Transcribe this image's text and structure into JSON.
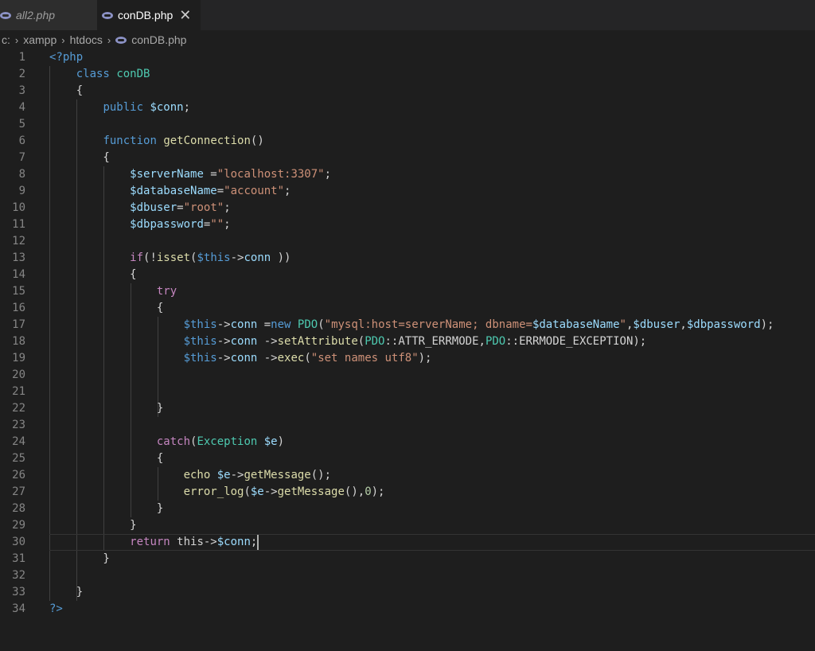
{
  "tabs": [
    {
      "label": "all2.php",
      "active": false,
      "icon": "php-icon"
    },
    {
      "label": "conDB.php",
      "active": true,
      "icon": "php-icon",
      "close_glyph": "✕"
    }
  ],
  "breadcrumb": [
    "c:",
    "xampp",
    "htdocs",
    "conDB.php"
  ],
  "editor": {
    "line_numbers": [
      "1",
      "2",
      "3",
      "4",
      "5",
      "6",
      "7",
      "8",
      "9",
      "10",
      "11",
      "12",
      "13",
      "14",
      "15",
      "16",
      "17",
      "18",
      "19",
      "20",
      "21",
      "22",
      "23",
      "24",
      "25",
      "26",
      "27",
      "28",
      "29",
      "30",
      "31",
      "32",
      "33",
      "34"
    ],
    "current_line": 30,
    "lines": [
      [
        [
          "k",
          "<?php"
        ]
      ],
      [
        [
          "p",
          "    "
        ],
        [
          "k",
          "class"
        ],
        [
          "p",
          " "
        ],
        [
          "c",
          "conDB"
        ]
      ],
      [
        [
          "p",
          "    {"
        ]
      ],
      [
        [
          "p",
          "        "
        ],
        [
          "k",
          "public"
        ],
        [
          "p",
          " "
        ],
        [
          "v",
          "$conn"
        ],
        [
          "p",
          ";"
        ]
      ],
      [],
      [
        [
          "p",
          "        "
        ],
        [
          "k",
          "function"
        ],
        [
          "p",
          " "
        ],
        [
          "f",
          "getConnection"
        ],
        [
          "p",
          "()"
        ]
      ],
      [
        [
          "p",
          "        {"
        ]
      ],
      [
        [
          "p",
          "            "
        ],
        [
          "v",
          "$serverName"
        ],
        [
          "p",
          " ="
        ],
        [
          "s",
          "\"localhost:3307\""
        ],
        [
          "p",
          ";"
        ]
      ],
      [
        [
          "p",
          "            "
        ],
        [
          "v",
          "$databaseName"
        ],
        [
          "p",
          "="
        ],
        [
          "s",
          "\"account\""
        ],
        [
          "p",
          ";"
        ]
      ],
      [
        [
          "p",
          "            "
        ],
        [
          "v",
          "$dbuser"
        ],
        [
          "p",
          "="
        ],
        [
          "s",
          "\"root\""
        ],
        [
          "p",
          ";"
        ]
      ],
      [
        [
          "p",
          "            "
        ],
        [
          "v",
          "$dbpassword"
        ],
        [
          "p",
          "="
        ],
        [
          "s",
          "\"\""
        ],
        [
          "p",
          ";"
        ]
      ],
      [],
      [
        [
          "p",
          "            "
        ],
        [
          "ctl",
          "if"
        ],
        [
          "p",
          "(!"
        ],
        [
          "f",
          "isset"
        ],
        [
          "p",
          "("
        ],
        [
          "k",
          "$this"
        ],
        [
          "p",
          "->"
        ],
        [
          "v",
          "conn"
        ],
        [
          "p",
          " ))"
        ]
      ],
      [
        [
          "p",
          "            {"
        ]
      ],
      [
        [
          "p",
          "                "
        ],
        [
          "ctl",
          "try"
        ]
      ],
      [
        [
          "p",
          "                {"
        ]
      ],
      [
        [
          "p",
          "                    "
        ],
        [
          "k",
          "$this"
        ],
        [
          "p",
          "->"
        ],
        [
          "v",
          "conn"
        ],
        [
          "p",
          " ="
        ],
        [
          "k",
          "new"
        ],
        [
          "p",
          " "
        ],
        [
          "c",
          "PDO"
        ],
        [
          "p",
          "("
        ],
        [
          "s",
          "\"mysql:host=serverName; dbname="
        ],
        [
          "v",
          "$databaseName"
        ],
        [
          "s",
          "\""
        ],
        [
          "p",
          ","
        ],
        [
          "v",
          "$dbuser"
        ],
        [
          "p",
          ","
        ],
        [
          "v",
          "$dbpassword"
        ],
        [
          "p",
          ");"
        ]
      ],
      [
        [
          "p",
          "                    "
        ],
        [
          "k",
          "$this"
        ],
        [
          "p",
          "->"
        ],
        [
          "v",
          "conn"
        ],
        [
          "p",
          " ->"
        ],
        [
          "f",
          "setAttribute"
        ],
        [
          "p",
          "("
        ],
        [
          "c",
          "PDO"
        ],
        [
          "p",
          "::ATTR_ERRMODE,"
        ],
        [
          "c",
          "PDO"
        ],
        [
          "p",
          "::ERRMODE_EXCEPTION);"
        ]
      ],
      [
        [
          "p",
          "                    "
        ],
        [
          "k",
          "$this"
        ],
        [
          "p",
          "->"
        ],
        [
          "v",
          "conn"
        ],
        [
          "p",
          " ->"
        ],
        [
          "f",
          "exec"
        ],
        [
          "p",
          "("
        ],
        [
          "s",
          "\"set names utf8\""
        ],
        [
          "p",
          ");"
        ]
      ],
      [],
      [],
      [
        [
          "p",
          "                }"
        ]
      ],
      [],
      [
        [
          "p",
          "                "
        ],
        [
          "ctl",
          "catch"
        ],
        [
          "p",
          "("
        ],
        [
          "c",
          "Exception"
        ],
        [
          "p",
          " "
        ],
        [
          "v",
          "$e"
        ],
        [
          "p",
          ")"
        ]
      ],
      [
        [
          "p",
          "                {"
        ]
      ],
      [
        [
          "p",
          "                    "
        ],
        [
          "f",
          "echo"
        ],
        [
          "p",
          " "
        ],
        [
          "v",
          "$e"
        ],
        [
          "p",
          "->"
        ],
        [
          "f",
          "getMessage"
        ],
        [
          "p",
          "();"
        ]
      ],
      [
        [
          "p",
          "                    "
        ],
        [
          "f",
          "error_log"
        ],
        [
          "p",
          "("
        ],
        [
          "v",
          "$e"
        ],
        [
          "p",
          "->"
        ],
        [
          "f",
          "getMessage"
        ],
        [
          "p",
          "(),"
        ],
        [
          "n",
          "0"
        ],
        [
          "p",
          ");"
        ]
      ],
      [
        [
          "p",
          "                }"
        ]
      ],
      [
        [
          "p",
          "            }"
        ]
      ],
      [
        [
          "p",
          "            "
        ],
        [
          "ctl",
          "return"
        ],
        [
          "p",
          " this->"
        ],
        [
          "v",
          "$conn"
        ],
        [
          "p",
          ";"
        ]
      ],
      [
        [
          "p",
          "        }"
        ]
      ],
      [],
      [
        [
          "p",
          "    }"
        ]
      ],
      [
        [
          "k",
          "?>"
        ]
      ]
    ]
  }
}
